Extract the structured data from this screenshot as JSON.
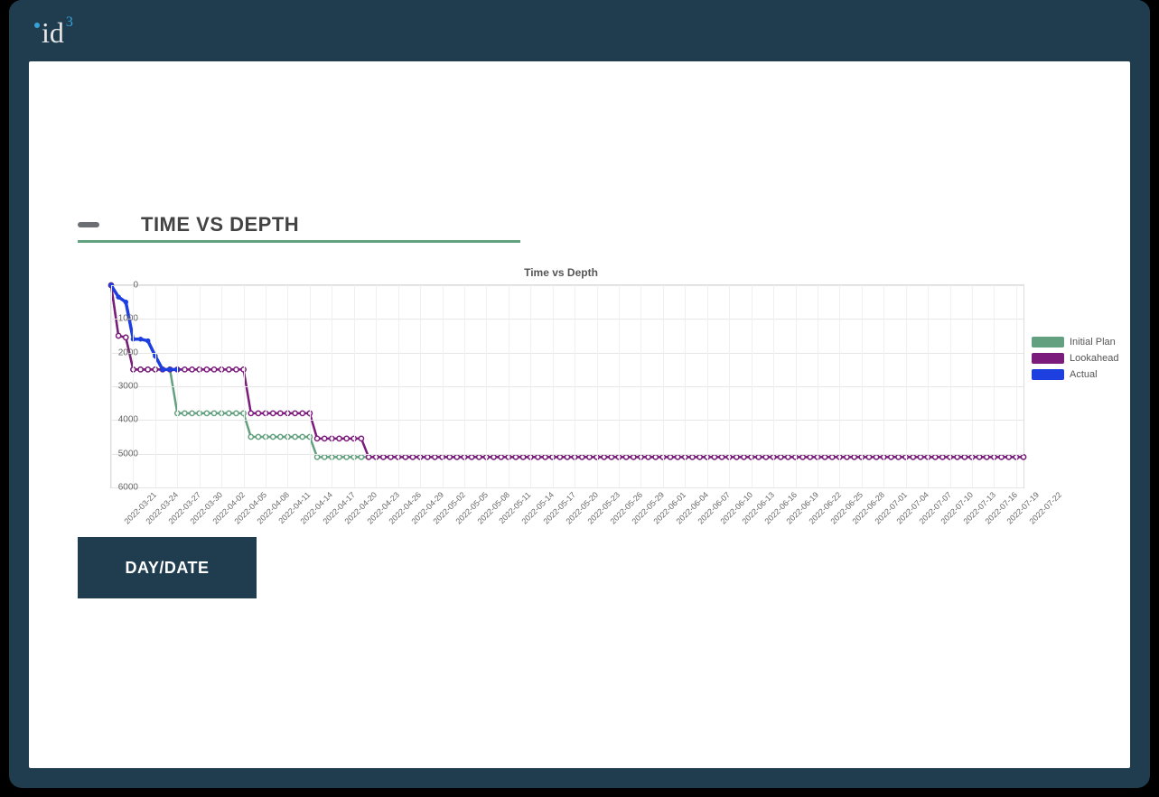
{
  "brand": {
    "name": "id",
    "super": "3"
  },
  "section": {
    "title": "TIME VS DEPTH"
  },
  "button": {
    "label": "DAY/DATE"
  },
  "legend": {
    "initial": "Initial Plan",
    "lookahead": "Lookahead",
    "actual": "Actual"
  },
  "colors": {
    "initial": "#63a07f",
    "lookahead": "#7b1b7b",
    "actual": "#1d3fe0",
    "frame": "#1f3d4f"
  },
  "chart_data": {
    "type": "line",
    "title": "Time vs Depth",
    "xlabel": "",
    "ylabel": "",
    "yticks": [
      0,
      1000,
      2000,
      3000,
      4000,
      5000,
      6000
    ],
    "ylim": [
      0,
      6000
    ],
    "x": [
      "2022-03-21",
      "2022-03-22",
      "2022-03-23",
      "2022-03-24",
      "2022-03-25",
      "2022-03-26",
      "2022-03-27",
      "2022-03-28",
      "2022-03-29",
      "2022-03-30",
      "2022-03-31",
      "2022-04-01",
      "2022-04-02",
      "2022-04-03",
      "2022-04-04",
      "2022-04-05",
      "2022-04-06",
      "2022-04-07",
      "2022-04-08",
      "2022-04-09",
      "2022-04-10",
      "2022-04-11",
      "2022-04-12",
      "2022-04-13",
      "2022-04-14",
      "2022-04-15",
      "2022-04-16",
      "2022-04-17",
      "2022-04-18",
      "2022-04-19",
      "2022-04-20",
      "2022-04-21",
      "2022-04-22",
      "2022-04-23",
      "2022-04-24",
      "2022-04-25",
      "2022-04-26",
      "2022-04-27",
      "2022-04-28",
      "2022-04-29",
      "2022-04-30",
      "2022-05-01",
      "2022-05-02",
      "2022-05-03",
      "2022-05-04",
      "2022-05-05",
      "2022-05-06",
      "2022-05-07",
      "2022-05-08",
      "2022-05-09",
      "2022-05-10",
      "2022-05-11",
      "2022-05-12",
      "2022-05-13",
      "2022-05-14",
      "2022-05-15",
      "2022-05-16",
      "2022-05-17",
      "2022-05-18",
      "2022-05-19",
      "2022-05-20",
      "2022-05-21",
      "2022-05-22",
      "2022-05-23",
      "2022-05-24",
      "2022-05-25",
      "2022-05-26",
      "2022-05-27",
      "2022-05-28",
      "2022-05-29",
      "2022-05-30",
      "2022-05-31",
      "2022-06-01",
      "2022-06-02",
      "2022-06-03",
      "2022-06-04",
      "2022-06-05",
      "2022-06-06",
      "2022-06-07",
      "2022-06-08",
      "2022-06-09",
      "2022-06-10",
      "2022-06-11",
      "2022-06-12",
      "2022-06-13",
      "2022-06-14",
      "2022-06-15",
      "2022-06-16",
      "2022-06-17",
      "2022-06-18",
      "2022-06-19",
      "2022-06-20",
      "2022-06-21",
      "2022-06-22",
      "2022-06-23",
      "2022-06-24",
      "2022-06-25",
      "2022-06-26",
      "2022-06-27",
      "2022-06-28",
      "2022-06-29",
      "2022-06-30",
      "2022-07-01",
      "2022-07-02",
      "2022-07-03",
      "2022-07-04",
      "2022-07-05",
      "2022-07-06",
      "2022-07-07",
      "2022-07-08",
      "2022-07-09",
      "2022-07-10",
      "2022-07-11",
      "2022-07-12",
      "2022-07-13",
      "2022-07-14",
      "2022-07-15",
      "2022-07-16",
      "2022-07-17",
      "2022-07-18",
      "2022-07-19",
      "2022-07-20",
      "2022-07-21",
      "2022-07-22",
      "2022-07-23"
    ],
    "xticks": [
      "2022-03-21",
      "2022-03-24",
      "2022-03-27",
      "2022-03-30",
      "2022-04-02",
      "2022-04-05",
      "2022-04-08",
      "2022-04-11",
      "2022-04-14",
      "2022-04-17",
      "2022-04-20",
      "2022-04-23",
      "2022-04-26",
      "2022-04-29",
      "2022-05-02",
      "2022-05-05",
      "2022-05-08",
      "2022-05-11",
      "2022-05-14",
      "2022-05-17",
      "2022-05-20",
      "2022-05-23",
      "2022-05-26",
      "2022-05-29",
      "2022-06-01",
      "2022-06-04",
      "2022-06-07",
      "2022-06-10",
      "2022-06-13",
      "2022-06-16",
      "2022-06-19",
      "2022-06-22",
      "2022-06-25",
      "2022-06-28",
      "2022-07-01",
      "2022-07-04",
      "2022-07-07",
      "2022-07-10",
      "2022-07-13",
      "2022-07-16",
      "2022-07-19",
      "2022-07-22"
    ],
    "series": [
      {
        "name": "Initial Plan",
        "color": "#63a07f",
        "values": [
          0,
          1500,
          1550,
          2500,
          2500,
          2500,
          2500,
          2500,
          2500,
          3800,
          3800,
          3800,
          3800,
          3800,
          3800,
          3800,
          3800,
          3800,
          3800,
          4500,
          4500,
          4500,
          4500,
          4500,
          4500,
          4500,
          4500,
          4500,
          5100,
          5100,
          5100,
          5100,
          5100,
          5100,
          5100,
          5100,
          5100,
          5100,
          5100,
          5100,
          5100,
          5100,
          5100,
          5100,
          5100,
          5100,
          5100,
          5100,
          5100,
          5100,
          5100,
          5100,
          5100,
          5100,
          5100,
          5100,
          5100,
          5100,
          5100,
          5100,
          5100,
          5100,
          5100,
          5100,
          5100,
          5100,
          5100,
          5100,
          5100,
          5100,
          5100,
          5100,
          5100,
          5100,
          5100,
          5100,
          5100,
          5100,
          5100,
          5100,
          5100,
          5100,
          5100,
          5100,
          5100,
          5100,
          5100,
          5100,
          5100,
          5100,
          5100,
          5100,
          5100,
          5100,
          5100,
          5100,
          5100,
          5100,
          5100,
          5100,
          5100,
          5100,
          5100,
          5100,
          5100,
          5100,
          5100,
          5100,
          5100,
          5100,
          5100,
          5100,
          5100,
          5100,
          5100,
          5100,
          5100,
          5100,
          5100,
          5100,
          5100,
          5100,
          5100,
          5100,
          5100
        ]
      },
      {
        "name": "Lookahead",
        "color": "#7b1b7b",
        "values": [
          0,
          1500,
          1550,
          2500,
          2500,
          2500,
          2500,
          2500,
          2500,
          2500,
          2500,
          2500,
          2500,
          2500,
          2500,
          2500,
          2500,
          2500,
          2500,
          3800,
          3800,
          3800,
          3800,
          3800,
          3800,
          3800,
          3800,
          3800,
          4550,
          4550,
          4550,
          4550,
          4550,
          4550,
          4550,
          5100,
          5100,
          5100,
          5100,
          5100,
          5100,
          5100,
          5100,
          5100,
          5100,
          5100,
          5100,
          5100,
          5100,
          5100,
          5100,
          5100,
          5100,
          5100,
          5100,
          5100,
          5100,
          5100,
          5100,
          5100,
          5100,
          5100,
          5100,
          5100,
          5100,
          5100,
          5100,
          5100,
          5100,
          5100,
          5100,
          5100,
          5100,
          5100,
          5100,
          5100,
          5100,
          5100,
          5100,
          5100,
          5100,
          5100,
          5100,
          5100,
          5100,
          5100,
          5100,
          5100,
          5100,
          5100,
          5100,
          5100,
          5100,
          5100,
          5100,
          5100,
          5100,
          5100,
          5100,
          5100,
          5100,
          5100,
          5100,
          5100,
          5100,
          5100,
          5100,
          5100,
          5100,
          5100,
          5100,
          5100,
          5100,
          5100,
          5100,
          5100,
          5100,
          5100,
          5100,
          5100,
          5100,
          5100,
          5100,
          5100,
          5100
        ]
      },
      {
        "name": "Actual",
        "color": "#1d3fe0",
        "values": [
          0,
          350,
          500,
          1600,
          1600,
          1650,
          2100,
          2500,
          2500,
          2500
        ]
      }
    ]
  }
}
